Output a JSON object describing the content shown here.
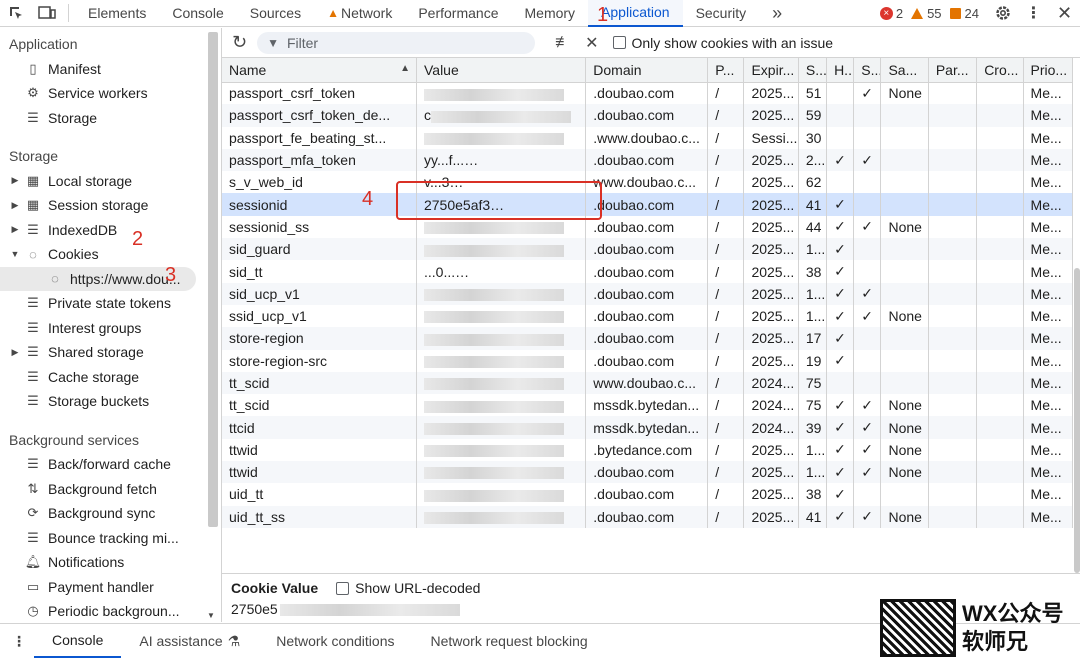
{
  "topbar": {
    "tabs": [
      "Elements",
      "Console",
      "Sources",
      "Network",
      "Performance",
      "Memory",
      "Application",
      "Security"
    ],
    "active_tab": "Application",
    "more": "»",
    "errors": "2",
    "warnings": "55",
    "issues": "24"
  },
  "sidebar": {
    "section_application": "Application",
    "application_items": [
      {
        "label": "Manifest",
        "icon": "file-icon"
      },
      {
        "label": "Service workers",
        "icon": "gears-icon"
      },
      {
        "label": "Storage",
        "icon": "database-icon"
      }
    ],
    "section_storage": "Storage",
    "storage_items": [
      {
        "label": "Local storage",
        "icon": "grid-icon",
        "arrow": "▶"
      },
      {
        "label": "Session storage",
        "icon": "grid-icon",
        "arrow": "▶"
      },
      {
        "label": "IndexedDB",
        "icon": "database-icon",
        "arrow": "▶"
      },
      {
        "label": "Cookies",
        "icon": "cookie-icon",
        "arrow": "▼"
      }
    ],
    "cookie_origin": "https://www.dou...",
    "storage_items2": [
      {
        "label": "Private state tokens",
        "icon": "database-icon"
      },
      {
        "label": "Interest groups",
        "icon": "database-icon"
      },
      {
        "label": "Shared storage",
        "icon": "database-icon",
        "arrow": "▶"
      },
      {
        "label": "Cache storage",
        "icon": "database-icon"
      },
      {
        "label": "Storage buckets",
        "icon": "database-icon"
      }
    ],
    "section_background": "Background services",
    "background_items": [
      {
        "label": "Back/forward cache",
        "icon": "database-icon"
      },
      {
        "label": "Background fetch",
        "icon": "fetch-icon"
      },
      {
        "label": "Background sync",
        "icon": "sync-icon"
      },
      {
        "label": "Bounce tracking mi...",
        "icon": "database-icon"
      },
      {
        "label": "Notifications",
        "icon": "bell-icon"
      },
      {
        "label": "Payment handler",
        "icon": "card-icon"
      },
      {
        "label": "Periodic backgroun...",
        "icon": "clock-icon"
      }
    ]
  },
  "toolbar": {
    "filter_placeholder": "Filter",
    "only_issue_label": "Only show cookies with an issue"
  },
  "table": {
    "columns": [
      "Name",
      "Value",
      "Domain",
      "P...",
      "Expir...",
      "S...",
      "H...",
      "S...",
      "Sa...",
      "Par...",
      "Cro...",
      "Prio..."
    ],
    "rows": [
      {
        "name": "passport_csrf_token",
        "value": "",
        "domain": ".doubao.com",
        "path": "/",
        "exp": "2025...",
        "size": "51",
        "h": "",
        "s": "✓",
        "sa": "None",
        "prio": "Me..."
      },
      {
        "name": "passport_csrf_token_de...",
        "value": "c",
        "domain": ".doubao.com",
        "path": "/",
        "exp": "2025...",
        "size": "59",
        "h": "",
        "s": "",
        "sa": "",
        "prio": "Me..."
      },
      {
        "name": "passport_fe_beating_st...",
        "value": "",
        "domain": ".www.doubao.c...",
        "path": "/",
        "exp": "Sessi...",
        "size": "30",
        "h": "",
        "s": "",
        "sa": "",
        "prio": "Me..."
      },
      {
        "name": "passport_mfa_token",
        "value": "yy...f...",
        "domain": ".doubao.com",
        "path": "/",
        "exp": "2025...",
        "size": "2...",
        "h": "✓",
        "s": "✓",
        "sa": "",
        "prio": "Me..."
      },
      {
        "name": "s_v_web_id",
        "value": "v...3",
        "domain": "www.doubao.c...",
        "path": "/",
        "exp": "2025...",
        "size": "62",
        "h": "",
        "s": "",
        "sa": "",
        "prio": "Me..."
      },
      {
        "name": "sessionid",
        "value": "2750e5af3",
        "domain": ".doubao.com",
        "path": "/",
        "exp": "2025...",
        "size": "41",
        "h": "✓",
        "s": "",
        "sa": "",
        "prio": "Me..."
      },
      {
        "name": "sessionid_ss",
        "value": "",
        "domain": ".doubao.com",
        "path": "/",
        "exp": "2025...",
        "size": "44",
        "h": "✓",
        "s": "✓",
        "sa": "None",
        "prio": "Me..."
      },
      {
        "name": "sid_guard",
        "value": "",
        "domain": ".doubao.com",
        "path": "/",
        "exp": "2025...",
        "size": "1...",
        "h": "✓",
        "s": "",
        "sa": "",
        "prio": "Me..."
      },
      {
        "name": "sid_tt",
        "value": "...0...",
        "domain": ".doubao.com",
        "path": "/",
        "exp": "2025...",
        "size": "38",
        "h": "✓",
        "s": "",
        "sa": "",
        "prio": "Me..."
      },
      {
        "name": "sid_ucp_v1",
        "value": "",
        "domain": ".doubao.com",
        "path": "/",
        "exp": "2025...",
        "size": "1...",
        "h": "✓",
        "s": "✓",
        "sa": "",
        "prio": "Me..."
      },
      {
        "name": "ssid_ucp_v1",
        "value": "",
        "domain": ".doubao.com",
        "path": "/",
        "exp": "2025...",
        "size": "1...",
        "h": "✓",
        "s": "✓",
        "sa": "None",
        "prio": "Me..."
      },
      {
        "name": "store-region",
        "value": "",
        "domain": ".doubao.com",
        "path": "/",
        "exp": "2025...",
        "size": "17",
        "h": "✓",
        "s": "",
        "sa": "",
        "prio": "Me..."
      },
      {
        "name": "store-region-src",
        "value": "",
        "domain": ".doubao.com",
        "path": "/",
        "exp": "2025...",
        "size": "19",
        "h": "✓",
        "s": "",
        "sa": "",
        "prio": "Me..."
      },
      {
        "name": "tt_scid",
        "value": "",
        "domain": "www.doubao.c...",
        "path": "/",
        "exp": "2024...",
        "size": "75",
        "h": "",
        "s": "",
        "sa": "",
        "prio": "Me..."
      },
      {
        "name": "tt_scid",
        "value": "",
        "domain": "mssdk.bytedan...",
        "path": "/",
        "exp": "2024...",
        "size": "75",
        "h": "✓",
        "s": "✓",
        "sa": "None",
        "prio": "Me..."
      },
      {
        "name": "ttcid",
        "value": "",
        "domain": "mssdk.bytedan...",
        "path": "/",
        "exp": "2024...",
        "size": "39",
        "h": "✓",
        "s": "✓",
        "sa": "None",
        "prio": "Me..."
      },
      {
        "name": "ttwid",
        "value": "",
        "domain": ".bytedance.com",
        "path": "/",
        "exp": "2025...",
        "size": "1...",
        "h": "✓",
        "s": "✓",
        "sa": "None",
        "prio": "Me..."
      },
      {
        "name": "ttwid",
        "value": "",
        "domain": ".doubao.com",
        "path": "/",
        "exp": "2025...",
        "size": "1...",
        "h": "✓",
        "s": "✓",
        "sa": "None",
        "prio": "Me..."
      },
      {
        "name": "uid_tt",
        "value": "",
        "domain": ".doubao.com",
        "path": "/",
        "exp": "2025...",
        "size": "38",
        "h": "✓",
        "s": "",
        "sa": "",
        "prio": "Me..."
      },
      {
        "name": "uid_tt_ss",
        "value": "",
        "domain": ".doubao.com",
        "path": "/",
        "exp": "2025...",
        "size": "41",
        "h": "✓",
        "s": "✓",
        "sa": "None",
        "prio": "Me..."
      }
    ]
  },
  "cookie_value": {
    "title": "Cookie Value",
    "show_decoded": "Show URL-decoded",
    "value": "2750e5"
  },
  "bottom": {
    "tabs": [
      "Console",
      "AI assistance",
      "Network conditions",
      "Network request blocking"
    ],
    "active": "Console"
  },
  "annotations": [
    "1",
    "2",
    "3",
    "4"
  ],
  "watermark": {
    "line1": "WX公众号",
    "line2": "软师兄"
  }
}
